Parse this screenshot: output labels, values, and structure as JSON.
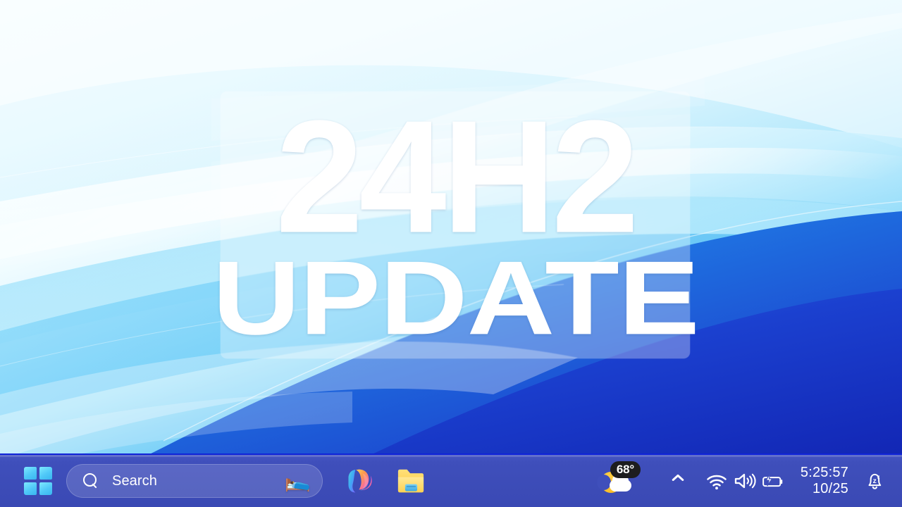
{
  "desktop": {
    "wallpaper_name": "windows-11-bloom-abstract-waves",
    "palette": {
      "top_light": "#effaff",
      "cyan_mid": "#a8e9fa",
      "sky": "#4fc3f7",
      "azure": "#1a7fe0",
      "deep_blue": "#1a36c8",
      "royal_blue": "#1226b8"
    }
  },
  "overlay": {
    "panel_tint": "#ffffff",
    "line1": "24H2",
    "line2": "UPDATE"
  },
  "taskbar": {
    "background_color": "#3f4fbb",
    "accent_top_border": "#1024d8",
    "start": {
      "label": "Start",
      "icon": "windows-logo-icon"
    },
    "search": {
      "icon": "search-icon",
      "placeholder": "Search",
      "value": "Search",
      "trailing_emoji": "🛌",
      "trailing_emoji_name": "search-highlight-emoji"
    },
    "pinned": [
      {
        "name": "copilot",
        "label": "Copilot",
        "icon": "copilot-icon"
      },
      {
        "name": "file-explorer",
        "label": "File Explorer",
        "icon": "folder-icon"
      }
    ],
    "tray": {
      "weather": {
        "temperature": "68°",
        "icon": "moon-cloud-icon",
        "label": "Weather"
      },
      "overflow": {
        "icon": "chevron-up-icon",
        "label": "Show hidden icons"
      },
      "icons": [
        {
          "name": "wifi",
          "label": "Network",
          "icon": "wifi-icon"
        },
        {
          "name": "volume",
          "label": "Volume",
          "icon": "speaker-icon"
        },
        {
          "name": "battery",
          "label": "Battery charging",
          "icon": "battery-charging-icon"
        }
      ],
      "clock": {
        "time": "5:25:57",
        "date": "10/25"
      },
      "notifications": {
        "icon": "bell-dnd-icon",
        "label": "Do not disturb",
        "badge_letter": "z"
      }
    }
  }
}
